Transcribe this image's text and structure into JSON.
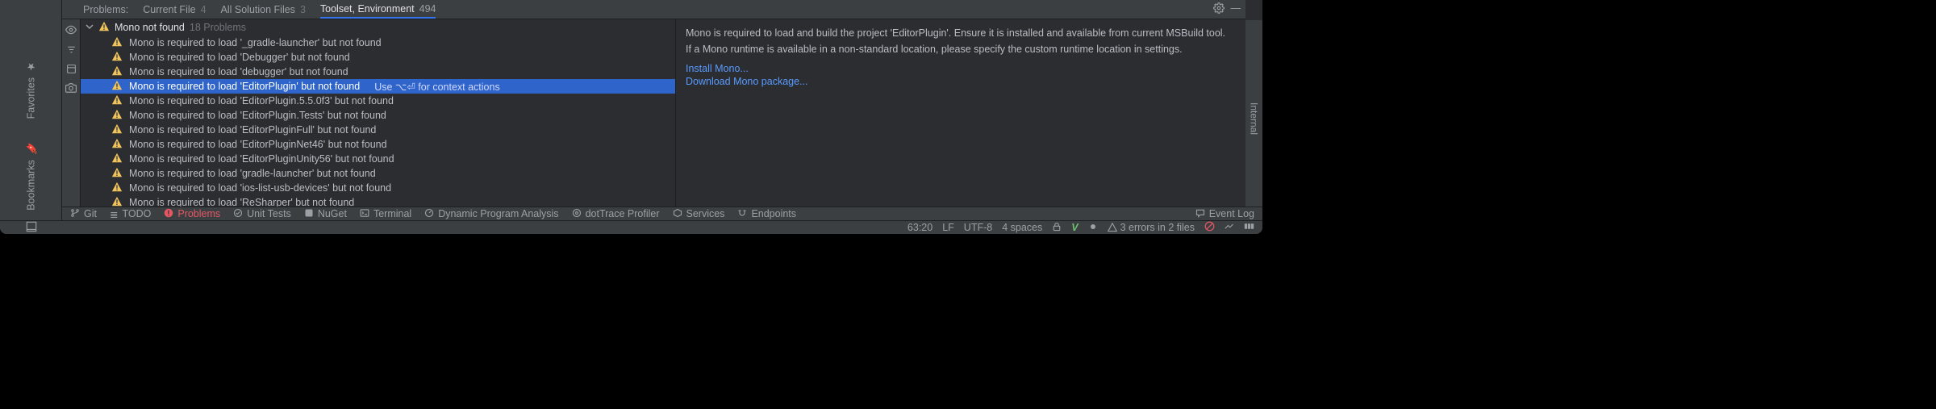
{
  "tabs": {
    "label0": "Problems:",
    "t1": {
      "name": "Current File",
      "count": "4"
    },
    "t2": {
      "name": "All Solution Files",
      "count": "3"
    },
    "t3": {
      "name": "Toolset, Environment",
      "count": "494"
    }
  },
  "root": {
    "title": "Mono not found",
    "count": "18 Problems"
  },
  "items": [
    {
      "text": "Mono is required to load '_gradle-launcher' but not found"
    },
    {
      "text": "Mono is required to load 'Debugger' but not found"
    },
    {
      "text": "Mono is required to load 'debugger' but not found"
    },
    {
      "text": "Mono is required to load 'EditorPlugin' but not found",
      "selected": true,
      "hint": "Use ⌥⏎ for context actions"
    },
    {
      "text": "Mono is required to load 'EditorPlugin.5.5.0f3' but not found"
    },
    {
      "text": "Mono is required to load 'EditorPlugin.Tests' but not found"
    },
    {
      "text": "Mono is required to load 'EditorPluginFull' but not found"
    },
    {
      "text": "Mono is required to load 'EditorPluginNet46' but not found"
    },
    {
      "text": "Mono is required to load 'EditorPluginUnity56' but not found"
    },
    {
      "text": "Mono is required to load 'gradle-launcher' but not found"
    },
    {
      "text": "Mono is required to load 'ios-list-usb-devices' but not found"
    },
    {
      "text": "Mono is required to load 'ReSharper' but not found"
    }
  ],
  "detail": {
    "line1": "Mono is required to load and build the project 'EditorPlugin'. Ensure it is installed and available from current MSBuild tool.",
    "line2": "If a Mono runtime is available in a non-standard location, please specify the custom runtime location in settings.",
    "link1": "Install Mono...",
    "link2": "Download Mono package..."
  },
  "toolbar": {
    "git": "Git",
    "todo": "TODO",
    "problems": "Problems",
    "unit": "Unit Tests",
    "nuget": "NuGet",
    "terminal": "Terminal",
    "dpa": "Dynamic Program Analysis",
    "dot": "dotTrace Profiler",
    "services": "Services",
    "endpoints": "Endpoints",
    "eventlog": "Event Log"
  },
  "status": {
    "pos": "63:20",
    "le": "LF",
    "enc": "UTF-8",
    "indent": "4 spaces",
    "errors": "3 errors in 2 files"
  },
  "leftRail": {
    "fav": "Favorites",
    "bm": "Bookmarks"
  },
  "rightRail": {
    "label": "Internal"
  }
}
